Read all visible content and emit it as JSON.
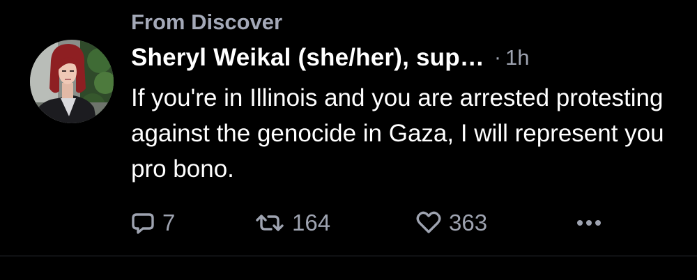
{
  "post": {
    "context_label": "From Discover",
    "author": {
      "display_name": "Sheryl Weikal (she/her), sup…"
    },
    "separator": "·",
    "timestamp": "1h",
    "text": "If you're in Illinois and you are arrested protesting against the genocide in Gaza, I will represent you pro bono.",
    "actions": {
      "reply": {
        "icon": "reply-icon",
        "count": "7"
      },
      "repost": {
        "icon": "repost-icon",
        "count": "164"
      },
      "like": {
        "icon": "heart-icon",
        "count": "363"
      },
      "more": {
        "icon": "more-icon"
      }
    }
  },
  "colors": {
    "background": "#000000",
    "primary_text": "#ffffff",
    "secondary_text": "#9ea3b0",
    "divider": "#2a2d35"
  }
}
